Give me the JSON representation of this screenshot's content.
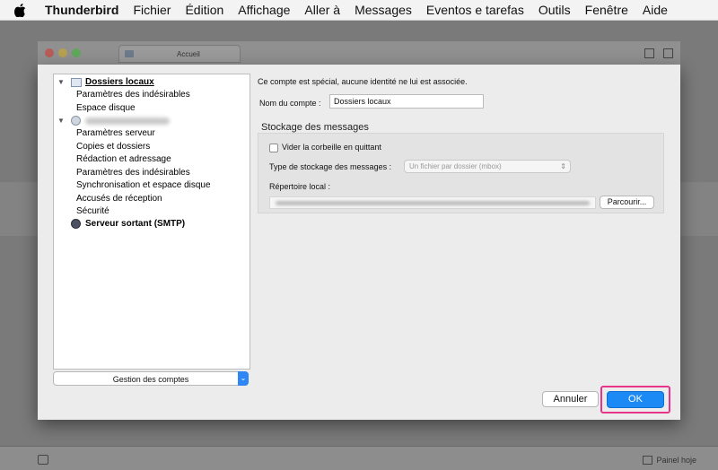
{
  "menubar": {
    "app_name": "Thunderbird",
    "items": [
      "Fichier",
      "Édition",
      "Affichage",
      "Aller à",
      "Messages",
      "Eventos e tarefas",
      "Outils",
      "Fenêtre",
      "Aide"
    ]
  },
  "background": {
    "tab_title": "Accueil",
    "status_text": "Painel hoje"
  },
  "tree": {
    "local_folders": "Dossiers locaux",
    "local_children": [
      "Paramètres des indésirables",
      "Espace disque"
    ],
    "account_children": [
      "Paramètres serveur",
      "Copies et dossiers",
      "Rédaction et adressage",
      "Paramètres des indésirables",
      "Synchronisation et espace disque",
      "Accusés de réception",
      "Sécurité"
    ],
    "smtp": "Serveur sortant (SMTP)"
  },
  "account_actions": {
    "label": "Gestion des comptes"
  },
  "pane": {
    "intro": "Ce compte est spécial, aucune identité ne lui est associée.",
    "name_label": "Nom du compte :",
    "name_value": "Dossiers locaux",
    "section_title": "Stockage des messages",
    "empty_trash_label": "Vider la corbeille en quittant",
    "empty_trash_checked": false,
    "storage_type_label": "Type de stockage des messages :",
    "storage_type_value": "Un fichier par dossier (mbox)",
    "local_dir_label": "Répertoire local :",
    "browse_label": "Parcourir..."
  },
  "buttons": {
    "cancel": "Annuler",
    "ok": "OK"
  },
  "colors": {
    "ok_button": "#1c8af5",
    "highlight": "#e8348a"
  }
}
